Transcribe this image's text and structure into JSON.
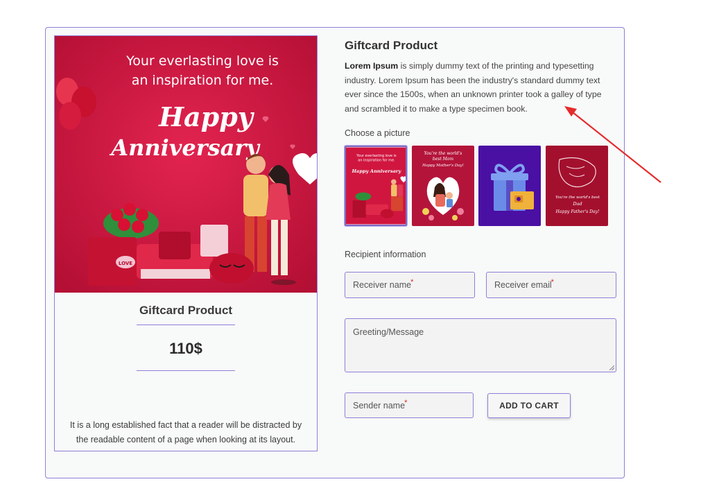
{
  "preview": {
    "image_headline_line1": "Your everlasting love is",
    "image_headline_line2": "an inspiration for me.",
    "image_script_line1": "Happy",
    "image_script_line2": "Anniversary",
    "image_gift_tag": "LOVE",
    "title": "Giftcard Product",
    "price": "110$",
    "description": "It is a long established fact that a reader will be distracted by the readable content of a page when looking at its layout."
  },
  "product": {
    "title": "Giftcard Product",
    "desc_bold": "Lorem Ipsum",
    "desc_rest": " is simply dummy text of the printing and typesetting industry. Lorem Ipsum has been the industry's standard dummy text ever since the 1500s, when an unknown printer took a galley of type and scrambled it to make a type specimen book."
  },
  "picture_section": {
    "label": "Choose a picture",
    "thumbnails": [
      {
        "name": "anniversary",
        "line1": "Your everlasting love is",
        "line2": "an inspiration for me.",
        "script": "Happy Anniversary",
        "selected": true
      },
      {
        "name": "mothers-day",
        "line1": "You're the world's",
        "line2": "best Mom",
        "script": "Happy Mother's Day!",
        "selected": false
      },
      {
        "name": "gift-box",
        "selected": false
      },
      {
        "name": "fathers-day",
        "line1": "You're the world's best",
        "line2": "Dad",
        "script": "Happy Father's Day!",
        "selected": false
      }
    ]
  },
  "recipient": {
    "label": "Recipient information",
    "receiver_name_placeholder": "Receiver name",
    "receiver_email_placeholder": "Receiver email",
    "message_placeholder": "Greeting/Message",
    "sender_name_placeholder": "Sender name",
    "required_mark": "*"
  },
  "actions": {
    "add_to_cart": "ADD TO CART"
  },
  "colors": {
    "accent_border": "#8e7fd6",
    "card_red": "#d0163f",
    "thumb_purple": "#4a0fa3",
    "annotation_red": "#e52b2b"
  }
}
